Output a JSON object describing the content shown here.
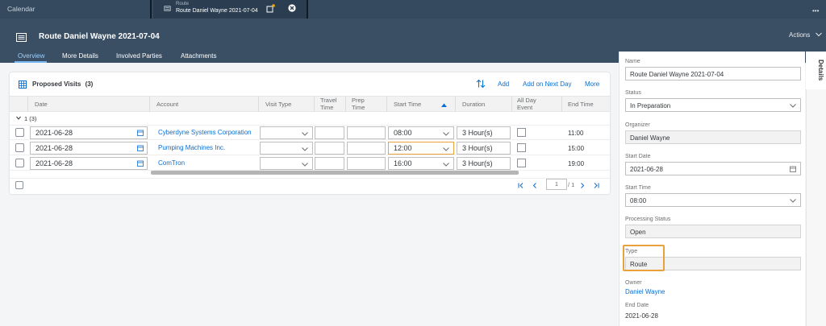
{
  "shell": {
    "calendar_tab": "Calendar",
    "route_tab_small": "Route",
    "route_tab_title": "Route Daniel Wayne 2021-07-04",
    "more": "•••"
  },
  "header": {
    "title": "Route Daniel Wayne 2021-07-04",
    "actions": "Actions",
    "tabs": [
      "Overview",
      "More Details",
      "Involved Parties",
      "Attachments"
    ],
    "active_tab": "Overview"
  },
  "visits": {
    "title": "Proposed Visits",
    "count": "(3)",
    "toolbar": {
      "add": "Add",
      "add_next_day": "Add on Next Day",
      "more": "More"
    },
    "columns": {
      "date": "Date",
      "account": "Account",
      "visit_type": "Visit Type",
      "travel_time": "Travel Time",
      "prep_time": "Prep Time",
      "start_time": "Start Time",
      "duration": "Duration",
      "all_day_event": "All Day Event",
      "end_time": "End Time"
    },
    "group_label": "1 (3)",
    "rows": [
      {
        "date": "2021-06-28",
        "account": "Cyberdyne Systems Corporation",
        "start_time": "08:00",
        "duration": "3 Hour(s)",
        "end_time": "11:00"
      },
      {
        "date": "2021-06-28",
        "account": "Pumping Machines Inc.",
        "start_time": "12:00",
        "duration": "3 Hour(s)",
        "end_time": "15:00"
      },
      {
        "date": "2021-06-28",
        "account": "ComTron",
        "start_time": "16:00",
        "duration": "3 Hour(s)",
        "end_time": "19:00"
      }
    ],
    "pager": {
      "page": "1",
      "of": "/ 1"
    }
  },
  "details": {
    "side_tab": "Details",
    "name_label": "Name",
    "name_value": "Route Daniel Wayne 2021-07-04",
    "status_label": "Status",
    "status_value": "In Preparation",
    "organizer_label": "Organizer",
    "organizer_value": "Daniel Wayne",
    "start_date_label": "Start Date",
    "start_date_value": "2021-06-28",
    "start_time_label": "Start Time",
    "start_time_value": "08:00",
    "processing_status_label": "Processing Status",
    "processing_status_value": "Open",
    "type_label": "Type",
    "type_value": "Route",
    "owner_label": "Owner",
    "owner_value": "Daniel Wayne",
    "end_date_label": "End Date",
    "end_date_value": "2021-06-28"
  },
  "colors": {
    "shell": "#354a5f",
    "header": "#3a4f64",
    "link": "#0a6ed1",
    "highlight": "#e9a23b",
    "active_tab": "#73b7f3"
  }
}
